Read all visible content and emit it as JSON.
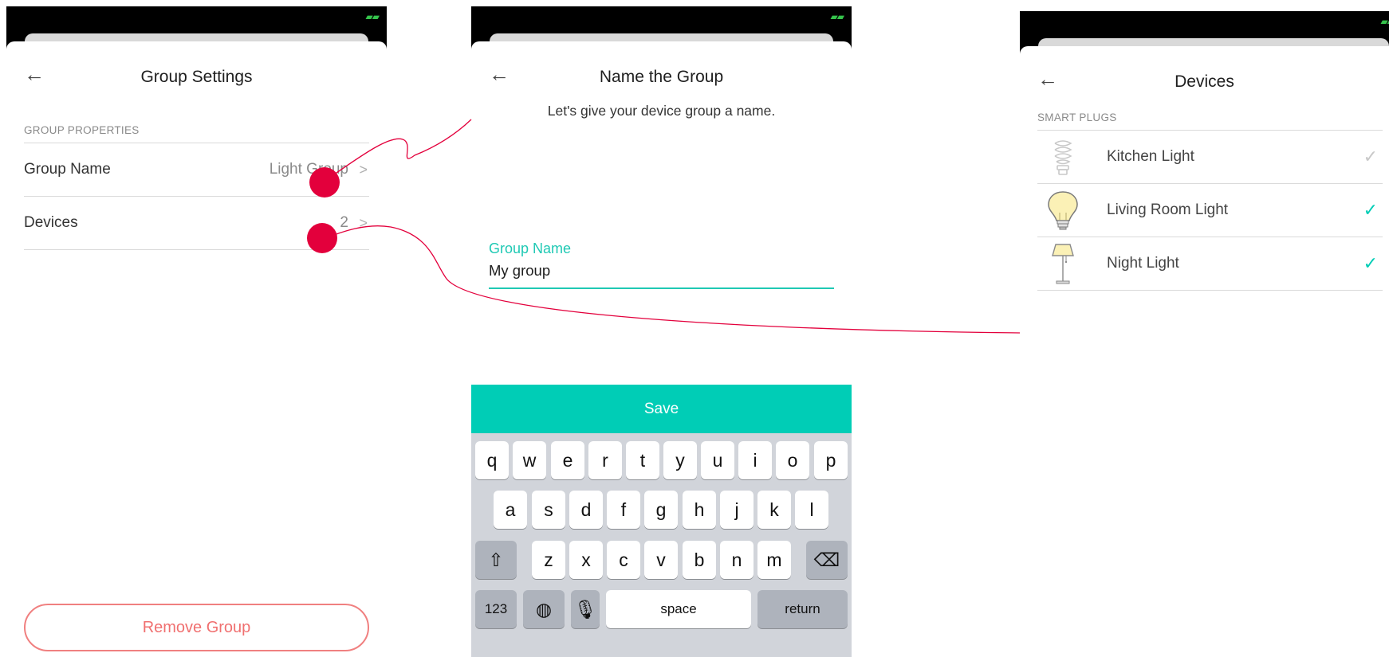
{
  "screens": {
    "group_settings": {
      "title": "Group Settings",
      "section_header": "GROUP PROPERTIES",
      "rows": [
        {
          "label": "Group Name",
          "value": "Light Group"
        },
        {
          "label": "Devices",
          "value": "2"
        }
      ],
      "remove_button": "Remove Group"
    },
    "name_group": {
      "title": "Name the Group",
      "subtitle": "Let's give your device group a name.",
      "field_label": "Group Name",
      "field_value": "My group",
      "save_button": "Save",
      "keyboard": {
        "row1": [
          "q",
          "w",
          "e",
          "r",
          "t",
          "y",
          "u",
          "i",
          "o",
          "p"
        ],
        "row2": [
          "a",
          "s",
          "d",
          "f",
          "g",
          "h",
          "j",
          "k",
          "l"
        ],
        "row3": [
          "z",
          "x",
          "c",
          "v",
          "b",
          "n",
          "m"
        ],
        "numbers_key": "123",
        "space_key": "space",
        "return_key": "return"
      }
    },
    "devices": {
      "title": "Devices",
      "section_header": "SMART PLUGS",
      "items": [
        {
          "name": "Kitchen Light",
          "checked": false,
          "icon": "cfl-bulb-icon"
        },
        {
          "name": "Living Room Light",
          "checked": true,
          "icon": "lightbulb-icon"
        },
        {
          "name": "Night Light",
          "checked": true,
          "icon": "floor-lamp-icon"
        }
      ]
    }
  },
  "colors": {
    "accent": "#00cdb6",
    "accent_text": "#1fc9b4",
    "danger": "#f07070",
    "annotation": "#e3003c",
    "battery": "#35c24b"
  }
}
